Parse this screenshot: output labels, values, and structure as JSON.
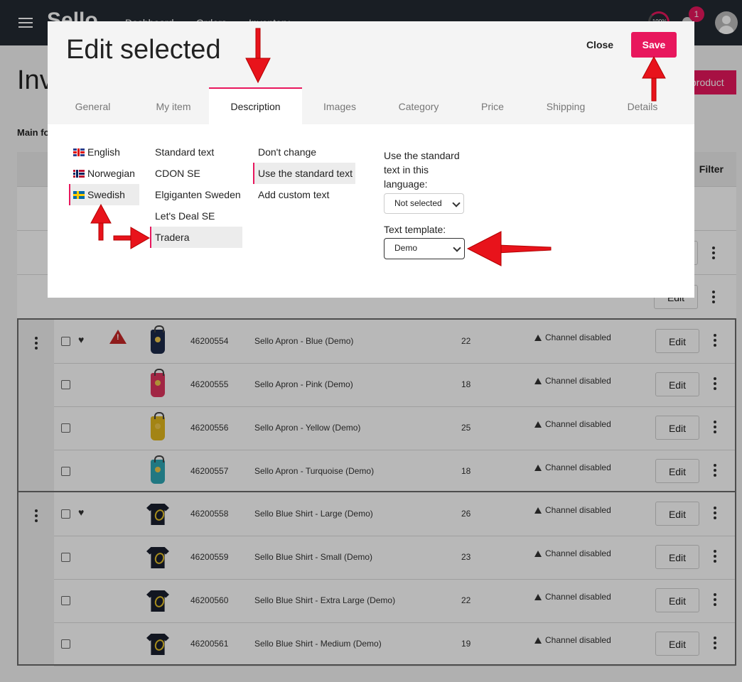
{
  "app": {
    "logo": "Sello",
    "nav": [
      "Dashboard",
      "Orders",
      "Inventory"
    ],
    "gauge_text": "100%",
    "notification_count": "1",
    "page_title": "Inv",
    "add_button": "product",
    "main_label": "Main fo",
    "filter_label": "Filter"
  },
  "table": {
    "edit_label": "Edit",
    "groups": [
      {
        "rows": [
          {
            "sku": "46200554",
            "name": "Sello Apron - Blue (Demo)",
            "qty": "22",
            "status": "Channel disabled",
            "heart": true,
            "warning": true,
            "thumb": "apron",
            "color": "#1d2a4a"
          },
          {
            "sku": "46200555",
            "name": "Sello Apron - Pink (Demo)",
            "qty": "18",
            "status": "Channel disabled",
            "heart": false,
            "warning": false,
            "thumb": "apron",
            "color": "#e0355f"
          },
          {
            "sku": "46200556",
            "name": "Sello Apron - Yellow (Demo)",
            "qty": "25",
            "status": "Channel disabled",
            "heart": false,
            "warning": false,
            "thumb": "apron",
            "color": "#e2b81d"
          },
          {
            "sku": "46200557",
            "name": "Sello Apron - Turquoise (Demo)",
            "qty": "18",
            "status": "Channel disabled",
            "heart": false,
            "warning": false,
            "thumb": "apron",
            "color": "#2fa7b5"
          }
        ]
      },
      {
        "rows": [
          {
            "sku": "46200558",
            "name": "Sello Blue Shirt - Large (Demo)",
            "qty": "26",
            "status": "Channel disabled",
            "heart": true,
            "warning": false,
            "thumb": "shirt",
            "color": "#1a1f2e"
          },
          {
            "sku": "46200559",
            "name": "Sello Blue Shirt - Small (Demo)",
            "qty": "23",
            "status": "Channel disabled",
            "heart": false,
            "warning": false,
            "thumb": "shirt",
            "color": "#1a1f2e"
          },
          {
            "sku": "46200560",
            "name": "Sello Blue Shirt - Extra Large (Demo)",
            "qty": "22",
            "status": "Channel disabled",
            "heart": false,
            "warning": false,
            "thumb": "shirt",
            "color": "#1a1f2e"
          },
          {
            "sku": "46200561",
            "name": "Sello Blue Shirt - Medium (Demo)",
            "qty": "19",
            "status": "Channel disabled",
            "heart": false,
            "warning": false,
            "thumb": "shirt",
            "color": "#1a1f2e"
          }
        ]
      }
    ]
  },
  "modal": {
    "title": "Edit selected",
    "close_label": "Close",
    "save_label": "Save",
    "tabs": [
      "General",
      "My item",
      "Description",
      "Images",
      "Category",
      "Price",
      "Shipping",
      "Details"
    ],
    "active_tab": "Description",
    "languages": [
      {
        "label": "English",
        "flag": "uk"
      },
      {
        "label": "Norwegian",
        "flag": "no"
      },
      {
        "label": "Swedish",
        "flag": "se",
        "selected": true
      }
    ],
    "channels": [
      "Standard text",
      "CDON SE",
      "Elgiganten Sweden",
      "Let's Deal SE",
      "Tradera"
    ],
    "selected_channel": "Tradera",
    "options": [
      "Don't change",
      "Use the standard text",
      "Add custom text"
    ],
    "selected_option": "Use the standard text",
    "standard_text_label": "Use the standard text in this language:",
    "standard_text_value": "Not selected",
    "text_template_label": "Text template:",
    "text_template_value": "Demo"
  },
  "colors": {
    "accent": "#e8175d",
    "topbar": "#232a33",
    "arrow": "#e8131b"
  }
}
